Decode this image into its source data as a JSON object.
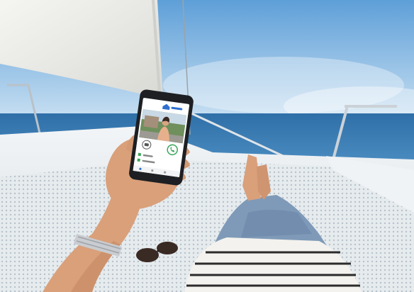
{
  "scene": {
    "sky_top": "#5e9fd8",
    "sky_bottom": "#d8ebf7",
    "sea": "#2f6fa8",
    "deck": "#e9eef2",
    "net": "#c9d3da",
    "skin": "#d9a07a",
    "jeans": "#7f9ab8",
    "shirt_stripe": "#2b2b2b"
  },
  "phone": {
    "brand_icon": "house-logo-icon",
    "call_icon": "phone-call-icon",
    "photo_icon": "camera-icon",
    "accent": "#3ba65a",
    "brand_color": "#2f6fd0"
  }
}
